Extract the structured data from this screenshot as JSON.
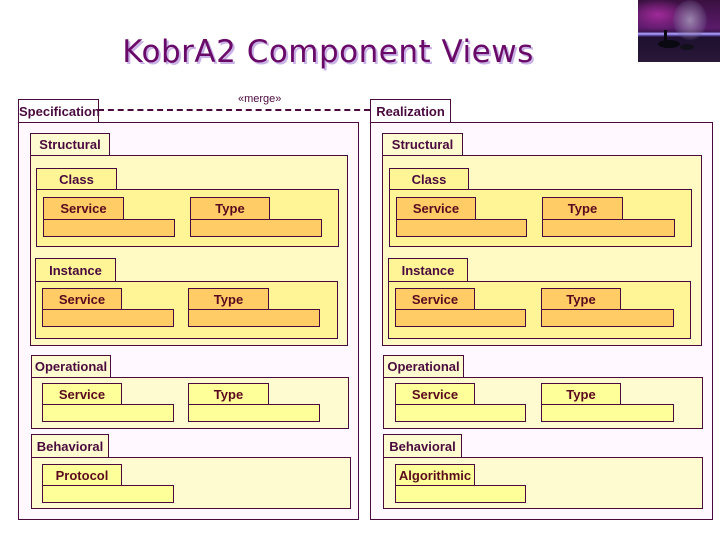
{
  "title": "KobrA2 Component Views",
  "thumbnail": {
    "icon": "decorative-swan-moon-image"
  },
  "relationship": {
    "stereotype": "«merge»",
    "style": "dashed"
  },
  "colors": {
    "line": "#4a0a3e",
    "title": "#6a0a68",
    "title_shadow": "#c9b3e6",
    "structural_fill": "#fff9c4",
    "class_instance_fill": "#fff596",
    "service_type_structural_fill": "#ffcc66",
    "operational_behavioral_fill": "#ffff99"
  },
  "specification": {
    "label": "Specification",
    "structural": {
      "label": "Structural",
      "class": {
        "label": "Class",
        "items": [
          "Service",
          "Type"
        ]
      },
      "instance": {
        "label": "Instance",
        "items": [
          "Service",
          "Type"
        ]
      }
    },
    "operational": {
      "label": "Operational",
      "items": [
        "Service",
        "Type"
      ]
    },
    "behavioral": {
      "label": "Behavioral",
      "items": [
        "Protocol"
      ]
    }
  },
  "realization": {
    "label": "Realization",
    "structural": {
      "label": "Structural",
      "class": {
        "label": "Class",
        "items": [
          "Service",
          "Type"
        ]
      },
      "instance": {
        "label": "Instance",
        "items": [
          "Service",
          "Type"
        ]
      }
    },
    "operational": {
      "label": "Operational",
      "items": [
        "Service",
        "Type"
      ]
    },
    "behavioral": {
      "label": "Behavioral",
      "items": [
        "Algorithmic"
      ]
    }
  }
}
